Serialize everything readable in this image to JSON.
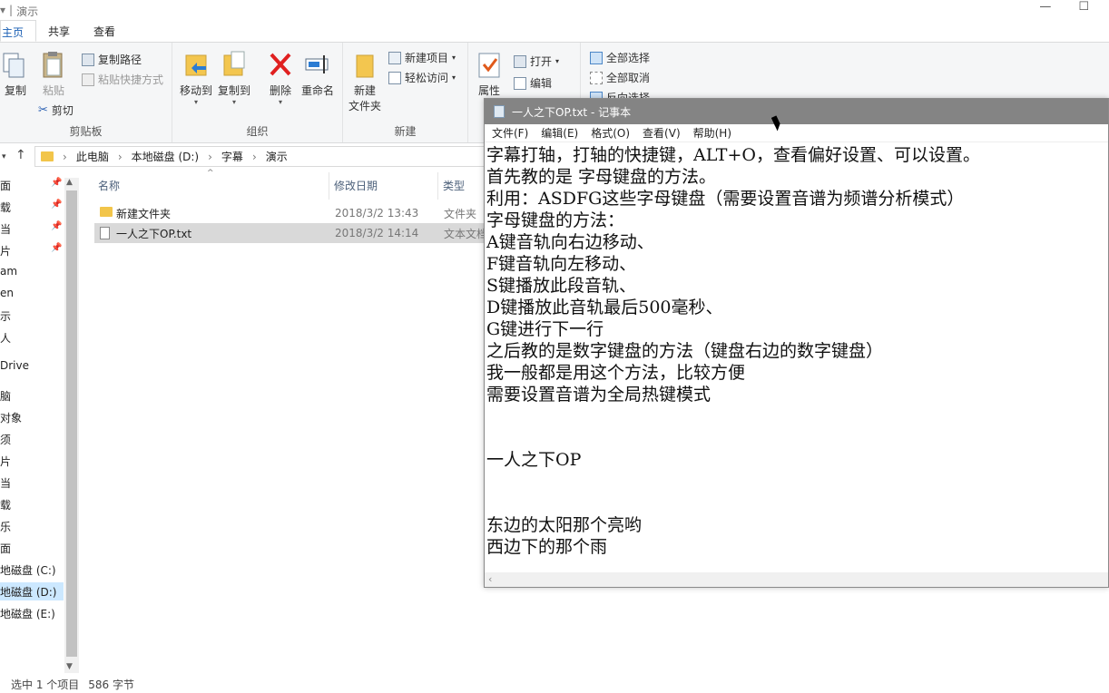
{
  "window": {
    "title": "演示"
  },
  "ribbon_tabs": [
    "主页",
    "共享",
    "查看"
  ],
  "ribbon": {
    "clipboard": {
      "copy": "复制",
      "paste": "粘贴",
      "copy_path": "复制路径",
      "paste_shortcut": "粘贴快捷方式",
      "cut": "剪切",
      "title": "剪贴板"
    },
    "organize": {
      "move_to": "移动到",
      "copy_to": "复制到",
      "delete": "删除",
      "rename": "重命名",
      "title": "组织"
    },
    "new": {
      "new_folder": "新建\n文件夹",
      "new_item": "新建项目",
      "easy_access": "轻松访问",
      "title": "新建"
    },
    "open": {
      "properties": "属性",
      "open": "打开",
      "edit": "编辑"
    },
    "select": {
      "select_all": "全部选择",
      "select_none": "全部取消",
      "invert": "反向选择"
    }
  },
  "address": {
    "segments": [
      "此电脑",
      "本地磁盘 (D:)",
      "字幕",
      "演示"
    ]
  },
  "nav_pane": [
    "面",
    "载",
    "当",
    "片",
    "am",
    "en",
    "示",
    "人",
    "Drive",
    "脑",
    "对象",
    "须",
    "片",
    "当",
    "载",
    "乐",
    "面",
    "地磁盘 (C:)",
    "地磁盘 (D:)",
    "地磁盘 (E:)"
  ],
  "columns": {
    "name": "名称",
    "date": "修改日期",
    "type": "类型"
  },
  "files": [
    {
      "name": "新建文件夹",
      "date": "2018/3/2 13:43",
      "type": "文件夹"
    },
    {
      "name": "一人之下OP.txt",
      "date": "2018/3/2 14:14",
      "type": "文本文档"
    }
  ],
  "status": {
    "selected": "选中 1 个项目",
    "size": "586 字节"
  },
  "notepad": {
    "title": "一人之下OP.txt - 记事本",
    "menu": [
      "文件(F)",
      "编辑(E)",
      "格式(O)",
      "查看(V)",
      "帮助(H)"
    ],
    "content": "字幕打轴，打轴的快捷键，ALT+O，查看偏好设置、可以设置。\n首先教的是 字母键盘的方法。\n利用：ASDFG这些字母键盘（需要设置音谱为频谱分析模式）\n字母键盘的方法：\nA键音轨向右边移动、\nF键音轨向左移动、\nS键播放此段音轨、\nD键播放此音轨最后500毫秒、\nG键进行下一行\n之后教的是数字键盘的方法（键盘右边的数字键盘）\n我一般都是用这个方法，比较方便\n需要设置音谱为全局热键模式\n\n\n一人之下OP\n\n\n东边的太阳那个亮哟\n西边下的那个雨"
  }
}
